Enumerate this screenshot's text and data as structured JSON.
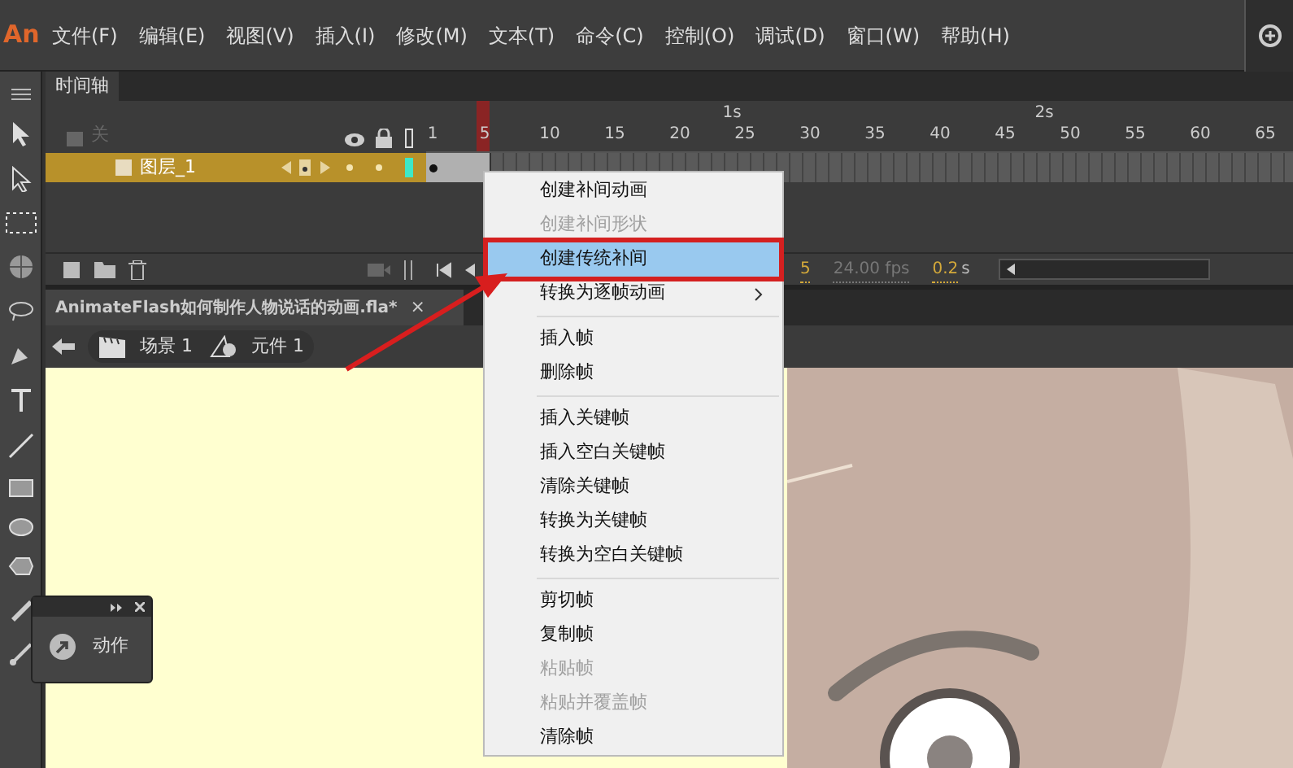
{
  "app_logo": "An",
  "menu_bar": [
    "文件(F)",
    "编辑(E)",
    "视图(V)",
    "插入(I)",
    "修改(M)",
    "文本(T)",
    "命令(C)",
    "控制(O)",
    "调试(D)",
    "窗口(W)",
    "帮助(H)"
  ],
  "timeline": {
    "tab": "时间轴",
    "layer_header": "关",
    "ruler": {
      "seconds": [
        "1s",
        "2s"
      ],
      "frames": [
        "1",
        "5",
        "10",
        "15",
        "20",
        "25",
        "30",
        "35",
        "40",
        "45",
        "50",
        "55",
        "60",
        "65"
      ]
    },
    "layers": [
      {
        "name": "图层_1",
        "selected": true
      }
    ],
    "status": {
      "frame": "5",
      "fps": "24.00 fps",
      "time": "0.2",
      "time_unit": "s"
    }
  },
  "document_tab": {
    "title": "AnimateFlash如何制作人物说话的动画.fla*",
    "close": "×"
  },
  "breadcrumb": [
    {
      "kind": "scene",
      "label": "场景 1"
    },
    {
      "kind": "symbol",
      "label": "元件 1"
    }
  ],
  "actions_panel": {
    "label": "动作"
  },
  "context_menu": {
    "items": [
      {
        "kind": "item",
        "label": "创建补间动画",
        "disabled": false,
        "selected": false,
        "submenu": false
      },
      {
        "kind": "item",
        "label": "创建补间形状",
        "disabled": true,
        "selected": false,
        "submenu": false
      },
      {
        "kind": "item",
        "label": "创建传统补间",
        "disabled": false,
        "selected": true,
        "submenu": false
      },
      {
        "kind": "item",
        "label": "转换为逐帧动画",
        "disabled": false,
        "selected": false,
        "submenu": true
      },
      {
        "kind": "separator"
      },
      {
        "kind": "item",
        "label": "插入帧",
        "disabled": false,
        "selected": false,
        "submenu": false
      },
      {
        "kind": "item",
        "label": "删除帧",
        "disabled": false,
        "selected": false,
        "submenu": false
      },
      {
        "kind": "separator"
      },
      {
        "kind": "item",
        "label": "插入关键帧",
        "disabled": false,
        "selected": false,
        "submenu": false
      },
      {
        "kind": "item",
        "label": "插入空白关键帧",
        "disabled": false,
        "selected": false,
        "submenu": false
      },
      {
        "kind": "item",
        "label": "清除关键帧",
        "disabled": false,
        "selected": false,
        "submenu": false
      },
      {
        "kind": "item",
        "label": "转换为关键帧",
        "disabled": false,
        "selected": false,
        "submenu": false
      },
      {
        "kind": "item",
        "label": "转换为空白关键帧",
        "disabled": false,
        "selected": false,
        "submenu": false
      },
      {
        "kind": "separator"
      },
      {
        "kind": "item",
        "label": "剪切帧",
        "disabled": false,
        "selected": false,
        "submenu": false
      },
      {
        "kind": "item",
        "label": "复制帧",
        "disabled": false,
        "selected": false,
        "submenu": false
      },
      {
        "kind": "item",
        "label": "粘贴帧",
        "disabled": true,
        "selected": false,
        "submenu": false
      },
      {
        "kind": "item",
        "label": "粘贴并覆盖帧",
        "disabled": true,
        "selected": false,
        "submenu": false
      },
      {
        "kind": "item",
        "label": "清除帧",
        "disabled": false,
        "selected": false,
        "submenu": false
      }
    ]
  }
}
